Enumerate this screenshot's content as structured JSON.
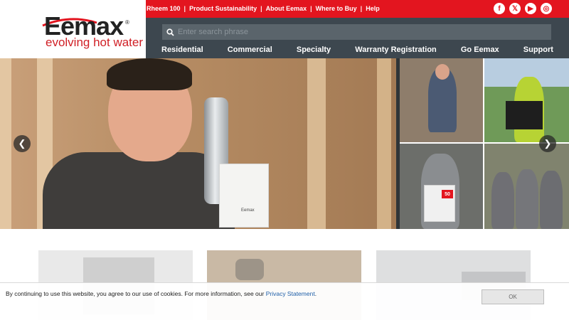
{
  "brand": {
    "logo_name": "Eemax",
    "registered_mark": "®",
    "tagline": "evolving hot water",
    "accent_color": "#e3151f",
    "nav_bg": "#3d474f"
  },
  "top_links": [
    "Rheem 100",
    "Product Sustainability",
    "About Eemax",
    "Where to Buy",
    "Help"
  ],
  "social": [
    {
      "icon": "facebook-icon",
      "glyph": "f"
    },
    {
      "icon": "x-twitter-icon",
      "glyph": "𝕏"
    },
    {
      "icon": "youtube-icon",
      "glyph": "▶"
    },
    {
      "icon": "instagram-icon",
      "glyph": "◎"
    }
  ],
  "search": {
    "placeholder": "Enter search phrase"
  },
  "main_nav": [
    "Residential",
    "Commercial",
    "Specialty",
    "Warranty Registration",
    "Go Eemax",
    "Support"
  ],
  "hero": {
    "prev_glyph": "❮",
    "next_glyph": "❯",
    "product_labels": {
      "box_brand": "Eemax",
      "promo_badge": "50"
    }
  },
  "cookie": {
    "text": "By continuing to use this website, you agree to our use of cookies. For more information, see our ",
    "link_text": "Privacy Statement",
    "link_suffix": ".",
    "ok_label": "OK"
  }
}
